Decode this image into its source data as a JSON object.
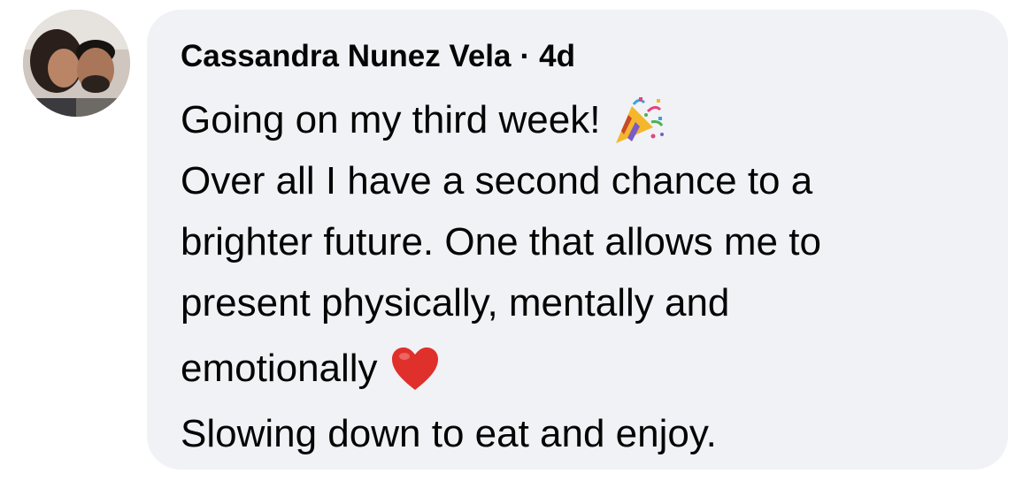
{
  "comment": {
    "author": "Cassandra Nunez Vela",
    "separator": "·",
    "timestamp": "4d",
    "lines": [
      "Going on my third week!",
      "Over all I have a second chance to a",
      "brighter future. One that allows me to",
      "present physically, mentally and",
      "emotionally",
      "Slowing down to eat and enjoy."
    ],
    "emojis": {
      "line1": "party-popper",
      "line5": "red-heart"
    }
  },
  "colors": {
    "bubble_bg": "#f0f2f5",
    "text": "#050505",
    "heart": "#e0302c"
  }
}
